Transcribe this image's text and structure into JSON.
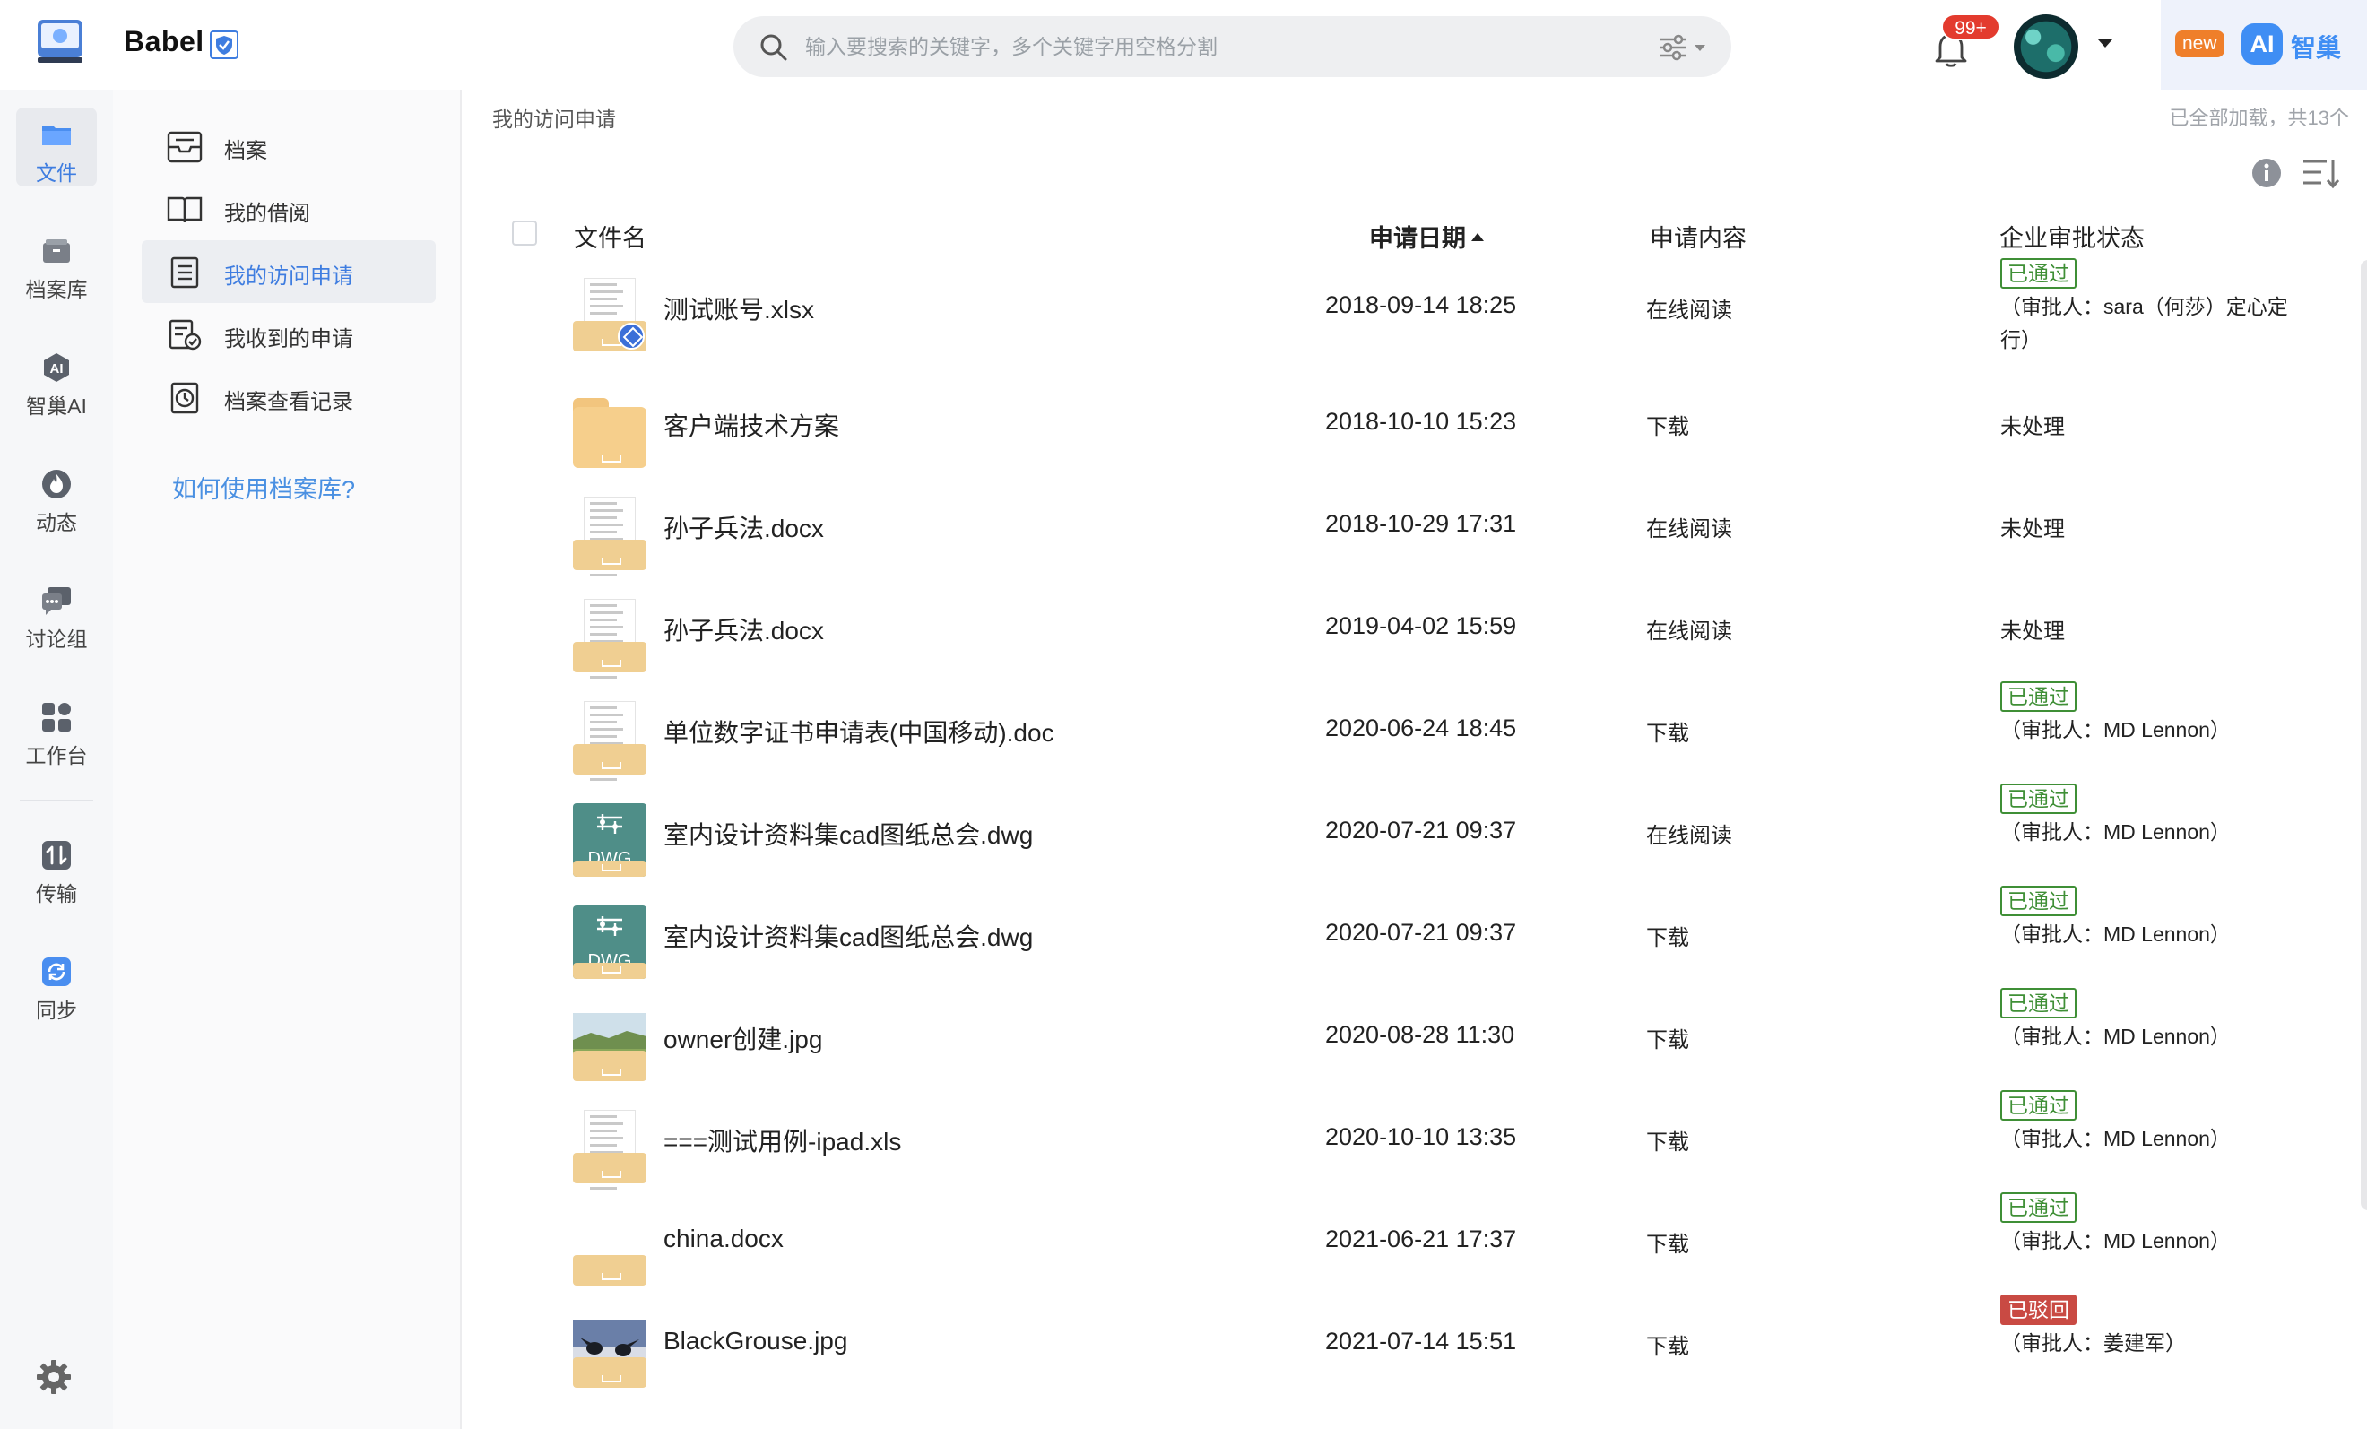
{
  "app": {
    "name": "Babel",
    "search_placeholder": "输入要搜索的关键字，多个关键字用空格分割",
    "notification_count": "99+",
    "ai_promo": {
      "badge": "new",
      "chip": "AI",
      "label": "智巢"
    }
  },
  "rail": {
    "items": [
      {
        "label": "文件",
        "icon": "folder-icon",
        "active": true
      },
      {
        "label": "档案库",
        "icon": "archive-box-icon"
      },
      {
        "label": "智巢AI",
        "icon": "ai-icon"
      },
      {
        "label": "动态",
        "icon": "fire-icon"
      },
      {
        "label": "讨论组",
        "icon": "chat-icon"
      },
      {
        "label": "工作台",
        "icon": "apps-icon"
      },
      {
        "label": "传输",
        "icon": "transfer-icon"
      },
      {
        "label": "同步",
        "icon": "sync-icon"
      }
    ]
  },
  "subnav": {
    "items": [
      {
        "label": "档案",
        "icon": "inbox-icon"
      },
      {
        "label": "我的借阅",
        "icon": "book-icon"
      },
      {
        "label": "我的访问申请",
        "icon": "document-list-icon",
        "active": true
      },
      {
        "label": "我收到的申请",
        "icon": "document-check-icon"
      },
      {
        "label": "档案查看记录",
        "icon": "clock-record-icon"
      }
    ],
    "help_link": "如何使用档案库?"
  },
  "main": {
    "title": "我的访问申请",
    "load_status": "已全部加载，共13个",
    "columns": {
      "name": "文件名",
      "date": "申请日期",
      "content": "申请内容",
      "status": "企业审批状态"
    },
    "rows": [
      {
        "name": "测试账号.xlsx",
        "date": "2018-09-14 18:25",
        "content": "在线阅读",
        "status_tag": "已通过",
        "status_kind": "approved",
        "approver": "（审批人：sara（何莎）定心定行）",
        "thumb": "sheet"
      },
      {
        "name": "客户端技术方案",
        "date": "2018-10-10 15:23",
        "content": "下载",
        "status_text": "未处理",
        "thumb": "folder"
      },
      {
        "name": "孙子兵法.docx",
        "date": "2018-10-29 17:31",
        "content": "在线阅读",
        "status_text": "未处理",
        "thumb": "doc"
      },
      {
        "name": "孙子兵法.docx",
        "date": "2019-04-02 15:59",
        "content": "在线阅读",
        "status_text": "未处理",
        "thumb": "doc"
      },
      {
        "name": "单位数字证书申请表(中国移动).doc",
        "date": "2020-06-24 18:45",
        "content": "下载",
        "status_tag": "已通过",
        "status_kind": "approved",
        "approver": "（审批人：MD Lennon）",
        "thumb": "doc"
      },
      {
        "name": "室内设计资料集cad图纸总会.dwg",
        "date": "2020-07-21 09:37",
        "content": "在线阅读",
        "status_tag": "已通过",
        "status_kind": "approved",
        "approver": "（审批人：MD Lennon）",
        "thumb": "dwg"
      },
      {
        "name": "室内设计资料集cad图纸总会.dwg",
        "date": "2020-07-21 09:37",
        "content": "下载",
        "status_tag": "已通过",
        "status_kind": "approved",
        "approver": "（审批人：MD Lennon）",
        "thumb": "dwg"
      },
      {
        "name": "owner创建.jpg",
        "date": "2020-08-28 11:30",
        "content": "下载",
        "status_tag": "已通过",
        "status_kind": "approved",
        "approver": "（审批人：MD Lennon）",
        "thumb": "landscape"
      },
      {
        "name": "===测试用例-ipad.xls",
        "date": "2020-10-10 13:35",
        "content": "下载",
        "status_tag": "已通过",
        "status_kind": "approved",
        "approver": "（审批人：MD Lennon）",
        "thumb": "doc"
      },
      {
        "name": "china.docx",
        "date": "2021-06-21 17:37",
        "content": "下载",
        "status_tag": "已通过",
        "status_kind": "approved",
        "approver": "（审批人：MD Lennon）",
        "thumb": "blank"
      },
      {
        "name": "BlackGrouse.jpg",
        "date": "2021-07-14 15:51",
        "content": "下载",
        "status_tag": "已驳回",
        "status_kind": "rejected",
        "approver": "（审批人：姜建军）",
        "thumb": "birds"
      }
    ]
  },
  "colors": {
    "accent": "#3f7de0",
    "approved": "#3f8f36",
    "rejected": "#c94a43",
    "badge": "#e33b2e",
    "tray": "#f0cf92"
  }
}
